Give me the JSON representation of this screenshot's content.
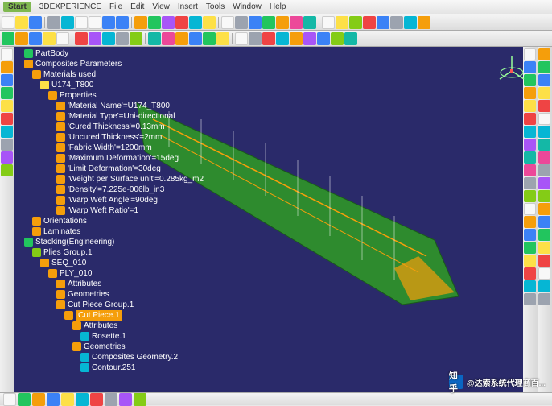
{
  "menu": {
    "start": "Start",
    "items": [
      "3DEXPERIENCE",
      "File",
      "Edit",
      "View",
      "Insert",
      "Tools",
      "Window",
      "Help"
    ]
  },
  "tree": {
    "nodes": [
      {
        "lvl": 1,
        "ico": "c-green",
        "label": "PartBody"
      },
      {
        "lvl": 1,
        "ico": "c-orange",
        "label": "Composites Parameters"
      },
      {
        "lvl": 2,
        "ico": "c-orange",
        "label": "Materials used"
      },
      {
        "lvl": 3,
        "ico": "c-yellow",
        "label": "U174_T800"
      },
      {
        "lvl": 4,
        "ico": "c-orange",
        "label": "Properties"
      },
      {
        "lvl": 5,
        "ico": "c-orange",
        "label": "'Material Name'=U174_T800"
      },
      {
        "lvl": 5,
        "ico": "c-orange",
        "label": "'Material Type'=Uni-directional"
      },
      {
        "lvl": 5,
        "ico": "c-orange",
        "label": "'Cured Thickness'=0.13mm"
      },
      {
        "lvl": 5,
        "ico": "c-orange",
        "label": "'Uncured Thickness'=2mm"
      },
      {
        "lvl": 5,
        "ico": "c-orange",
        "label": "'Fabric Width'=1200mm"
      },
      {
        "lvl": 5,
        "ico": "c-orange",
        "label": "'Maximum Deformation'=15deg"
      },
      {
        "lvl": 5,
        "ico": "c-orange",
        "label": "'Limit Deformation'=30deg"
      },
      {
        "lvl": 5,
        "ico": "c-orange",
        "label": "'Weight per Surface unit'=0.285kg_m2"
      },
      {
        "lvl": 5,
        "ico": "c-orange",
        "label": "'Density'=7.225e-006lb_in3"
      },
      {
        "lvl": 5,
        "ico": "c-orange",
        "label": "'Warp Weft Angle'=90deg"
      },
      {
        "lvl": 5,
        "ico": "c-orange",
        "label": "'Warp Weft Ratio'=1"
      },
      {
        "lvl": 2,
        "ico": "c-orange",
        "label": "Orientations"
      },
      {
        "lvl": 2,
        "ico": "c-orange",
        "label": "Laminates"
      },
      {
        "lvl": 1,
        "ico": "c-green",
        "label": "Stacking(Engineering)"
      },
      {
        "lvl": 2,
        "ico": "c-lime",
        "label": "Plies Group.1"
      },
      {
        "lvl": 3,
        "ico": "c-orange",
        "label": "SEQ_010"
      },
      {
        "lvl": 4,
        "ico": "c-orange",
        "label": "PLY_010"
      },
      {
        "lvl": 5,
        "ico": "c-orange",
        "label": "Attributes"
      },
      {
        "lvl": 5,
        "ico": "c-orange",
        "label": "Geometries"
      },
      {
        "lvl": 5,
        "ico": "c-orange",
        "label": "Cut Piece Group.1"
      },
      {
        "lvl": 6,
        "ico": "c-orange",
        "label": "Cut Piece.1",
        "sel": true
      },
      {
        "lvl": 7,
        "ico": "c-orange",
        "label": "Attributes"
      },
      {
        "lvl": 8,
        "ico": "c-cyan",
        "label": "Rosette.1"
      },
      {
        "lvl": 7,
        "ico": "c-orange",
        "label": "Geometries"
      },
      {
        "lvl": 8,
        "ico": "c-cyan",
        "label": "Composites Geometry.2"
      },
      {
        "lvl": 8,
        "ico": "c-cyan",
        "label": "Contour.251"
      }
    ]
  },
  "watermark": {
    "brand": "知乎",
    "text": "@达索系统代理商百..."
  }
}
